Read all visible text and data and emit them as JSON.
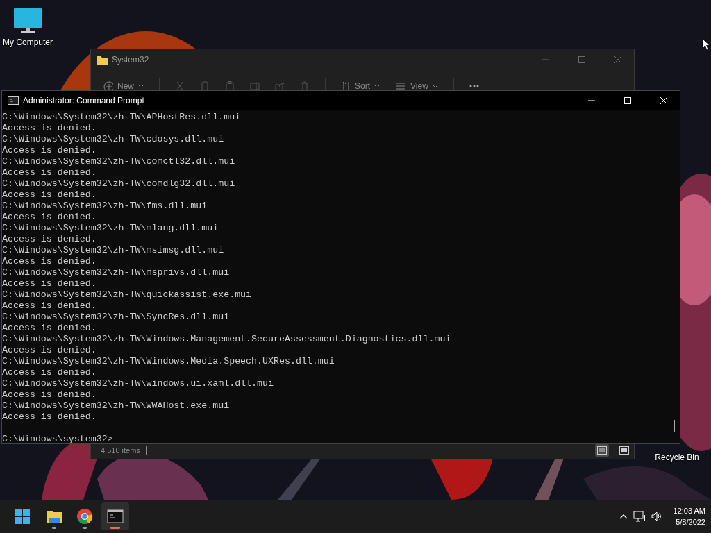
{
  "desktop_icons": [
    {
      "kind": "computer",
      "label": "My Computer"
    },
    {
      "kind": "recycle",
      "label": "Recycle Bin"
    }
  ],
  "explorer": {
    "title": "System32",
    "toolbar": [
      {
        "kind": "new",
        "label": "New"
      },
      {
        "kind": "cut"
      },
      {
        "kind": "copy"
      },
      {
        "kind": "paste"
      },
      {
        "kind": "rename"
      },
      {
        "kind": "share"
      },
      {
        "kind": "delete"
      },
      {
        "kind": "sort",
        "label": "Sort"
      },
      {
        "kind": "view",
        "label": "View"
      },
      {
        "kind": "more"
      }
    ],
    "status": "4,510 items",
    "views": [
      {
        "kind": "details",
        "selected": true
      },
      {
        "kind": "tiles",
        "selected": false
      }
    ]
  },
  "console": {
    "title": "Administrator: Command Prompt",
    "lines": [
      "C:\\Windows\\System32\\zh-TW\\APHostRes.dll.mui",
      "Access is denied.",
      "C:\\Windows\\System32\\zh-TW\\cdosys.dll.mui",
      "Access is denied.",
      "C:\\Windows\\System32\\zh-TW\\comctl32.dll.mui",
      "Access is denied.",
      "C:\\Windows\\System32\\zh-TW\\comdlg32.dll.mui",
      "Access is denied.",
      "C:\\Windows\\System32\\zh-TW\\fms.dll.mui",
      "Access is denied.",
      "C:\\Windows\\System32\\zh-TW\\mlang.dll.mui",
      "Access is denied.",
      "C:\\Windows\\System32\\zh-TW\\msimsg.dll.mui",
      "Access is denied.",
      "C:\\Windows\\System32\\zh-TW\\msprivs.dll.mui",
      "Access is denied.",
      "C:\\Windows\\System32\\zh-TW\\quickassist.exe.mui",
      "Access is denied.",
      "C:\\Windows\\System32\\zh-TW\\SyncRes.dll.mui",
      "Access is denied.",
      "C:\\Windows\\System32\\zh-TW\\Windows.Management.SecureAssessment.Diagnostics.dll.mui",
      "Access is denied.",
      "C:\\Windows\\System32\\zh-TW\\Windows.Media.Speech.UXRes.dll.mui",
      "Access is denied.",
      "C:\\Windows\\System32\\zh-TW\\windows.ui.xaml.dll.mui",
      "Access is denied.",
      "C:\\Windows\\System32\\zh-TW\\WWAHost.exe.mui",
      "Access is denied."
    ],
    "prompt": "C:\\Windows\\system32>"
  },
  "taskbar": {
    "apps": [
      {
        "kind": "start",
        "running": false,
        "selected": false
      },
      {
        "kind": "folder",
        "running": true,
        "selected": false
      },
      {
        "kind": "browser",
        "running": true,
        "selected": false
      },
      {
        "kind": "terminal",
        "running": true,
        "selected": true
      }
    ],
    "clock": {
      "time": "12:03 AM",
      "date": "5/8/2022"
    }
  }
}
